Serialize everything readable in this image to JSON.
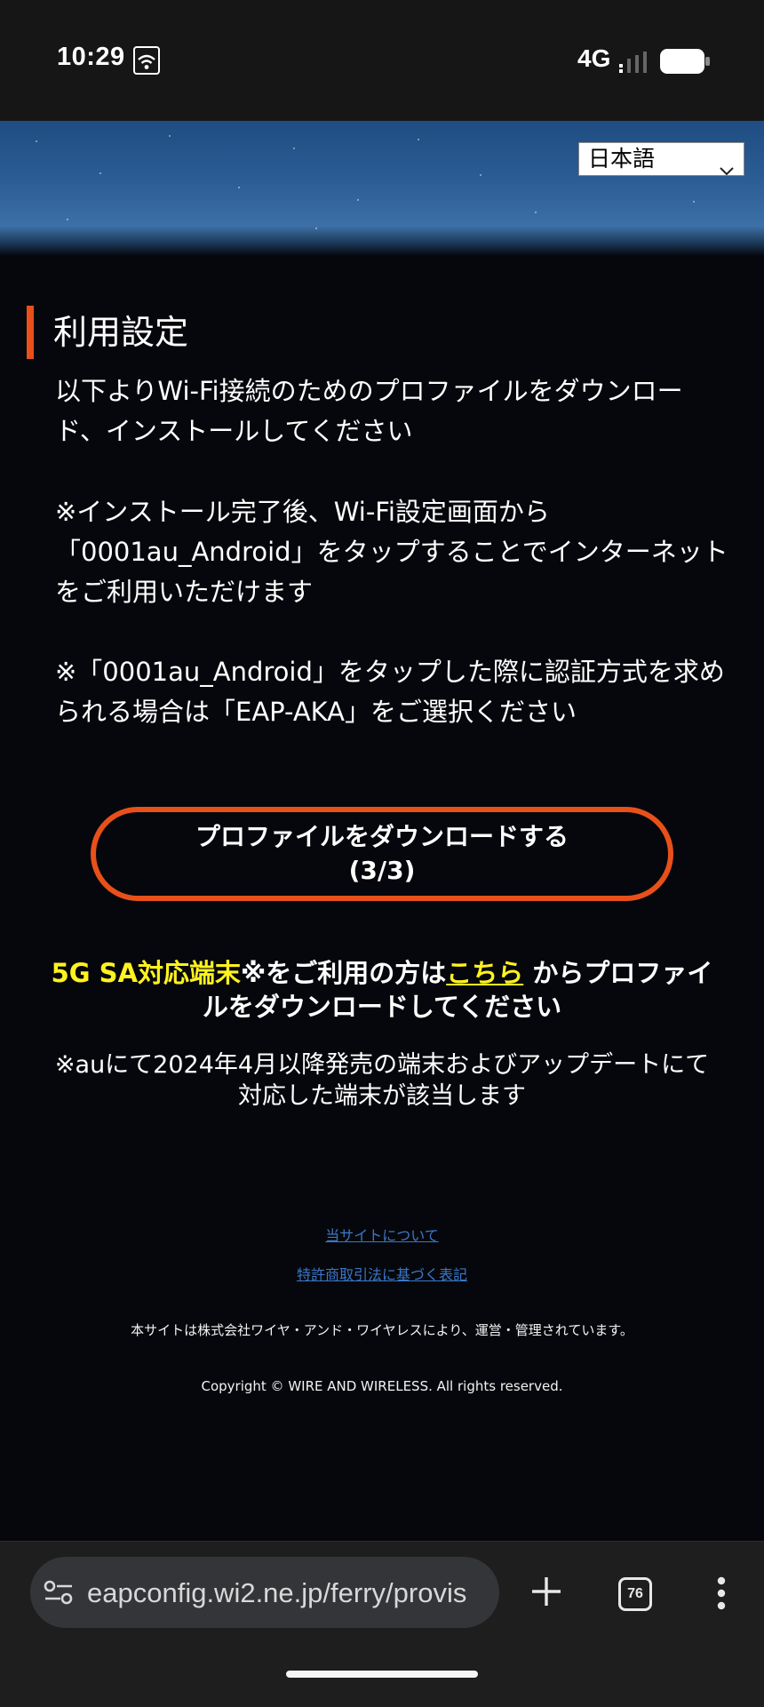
{
  "status_bar": {
    "time": "10:29",
    "network": "4G"
  },
  "language_select": {
    "selected": "日本語"
  },
  "section": {
    "heading": "利用設定"
  },
  "content": {
    "intro": "以下よりWi-Fi接続のためのプロファイルをダウンロード、インストールしてください",
    "note_install": "※インストール完了後、Wi-Fi設定画面から「0001au_Android」をタップすることでインターネットをご利用いただけます",
    "note_auth": "※「0001au_Android」をタップした際に認証方式を求められる場合は「EAP-AKA」をご選択ください"
  },
  "download_button": {
    "label": "プロファイルをダウンロードする",
    "progress": "(3/3)"
  },
  "sa_notice": {
    "highlight": "5G SA対応端末",
    "text_before_link": "※をご利用の方は",
    "link": "こちら",
    "text_after_link": "からプロファイルをダウンロードしてください",
    "sub": "※auにて2024年4月以降発売の端末およびアップデートにて対応した端末が該当します"
  },
  "footer": {
    "about_link": "当サイトについて",
    "commerce_link": "特許商取引法に基づく表記",
    "operator": "本サイトは株式会社ワイヤ・アンド・ワイヤレスにより、運営・管理されています。",
    "copyright": "Copyright © WIRE AND WIRELESS. All rights reserved."
  },
  "browser": {
    "url": "eapconfig.wi2.ne.jp/ferry/provis",
    "tab_count": "76"
  },
  "colors": {
    "accent": "#e8501a",
    "highlight": "#fff21f",
    "link": "#3a78c8",
    "background": "#06070c"
  },
  "icons": [
    "wifi-icon",
    "signal-icon",
    "battery-icon",
    "chevron-down-icon",
    "tune-icon",
    "plus-icon",
    "tabs-icon",
    "more-vert-icon"
  ]
}
